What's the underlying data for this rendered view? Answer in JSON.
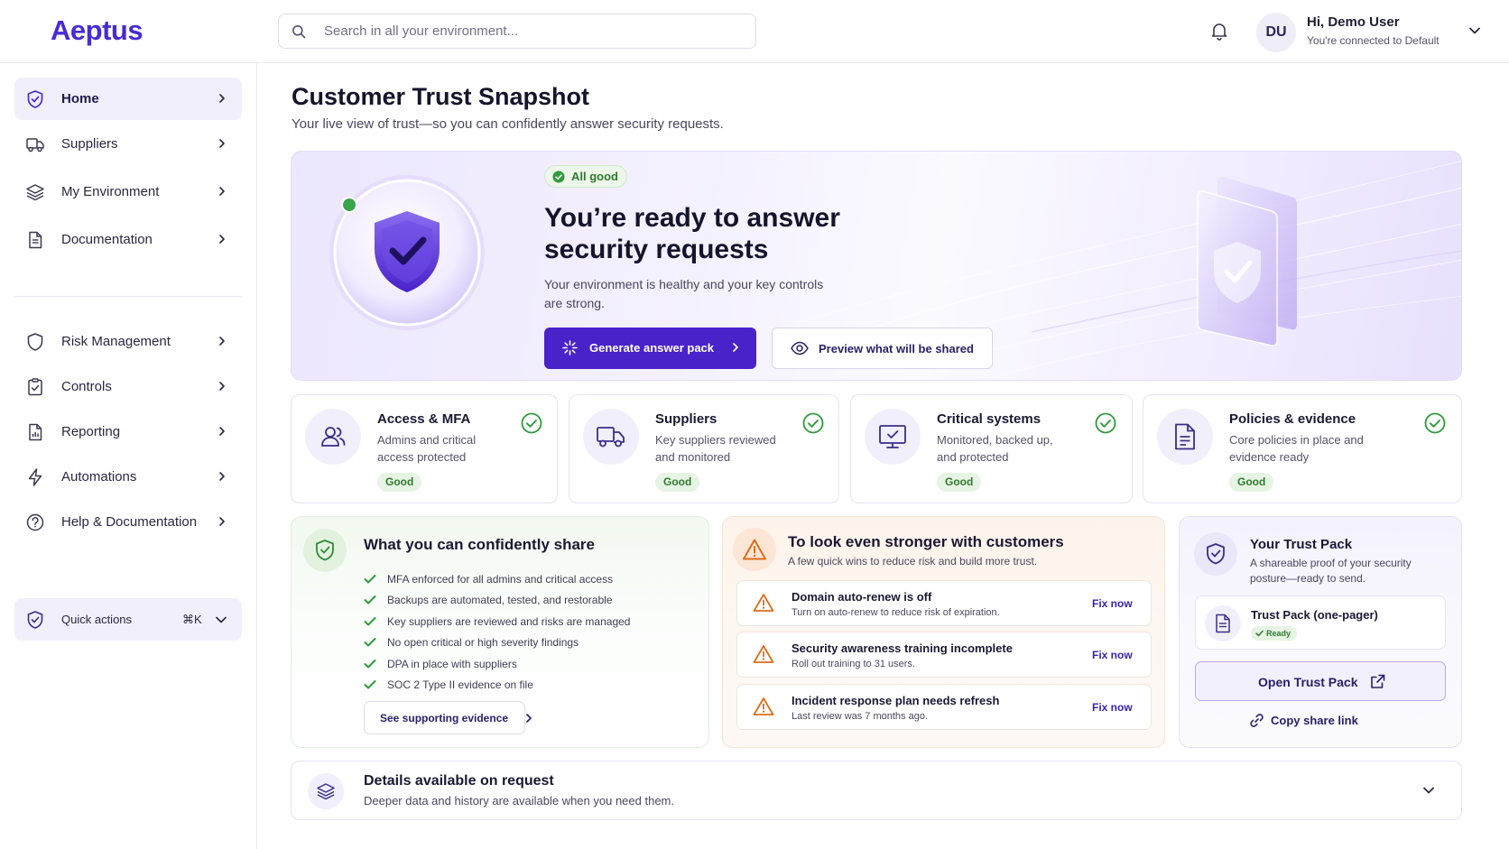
{
  "app": {
    "logo": "Aeptus"
  },
  "header": {
    "search_placeholder": "Search in all your environment...",
    "user_initials": "DU",
    "user_greeting": "Hi, Demo User",
    "user_connection": "You're connected to Default"
  },
  "sidebar": {
    "items": [
      {
        "label": "Home",
        "icon": "shield-check-icon",
        "active": true
      },
      {
        "label": "Suppliers",
        "icon": "truck-icon"
      },
      {
        "label": "My Environment",
        "icon": "layers-icon"
      },
      {
        "label": "Documentation",
        "icon": "document-icon"
      },
      {
        "label": "Risk Management",
        "icon": "shield-icon"
      },
      {
        "label": "Controls",
        "icon": "clipboard-check-icon"
      },
      {
        "label": "Reporting",
        "icon": "report-icon"
      },
      {
        "label": "Automations",
        "icon": "bolt-icon"
      },
      {
        "label": "Help & Documentation",
        "icon": "help-icon"
      }
    ],
    "quick_actions": {
      "label": "Quick actions",
      "shortcut": "⌘K"
    }
  },
  "page": {
    "title": "Customer Trust Snapshot",
    "subtitle": "Your live view of trust—so you can confidently answer security requests."
  },
  "hero": {
    "badge": "All good",
    "title": "You’re ready to answer security requests",
    "description": "Your environment is healthy and your key controls are strong.",
    "primary_button": "Generate answer pack",
    "secondary_button": "Preview what will be shared"
  },
  "status_cards": [
    {
      "title": "Access & MFA",
      "description": "Admins and critical access protected",
      "status": "Good",
      "icon": "users-icon"
    },
    {
      "title": "Suppliers",
      "description": "Key suppliers reviewed and monitored",
      "status": "Good",
      "icon": "truck-icon"
    },
    {
      "title": "Critical systems",
      "description": "Monitored, backed up, and protected",
      "status": "Good",
      "icon": "monitor-check-icon"
    },
    {
      "title": "Policies & evidence",
      "description": "Core policies in place and evidence ready",
      "status": "Good",
      "icon": "document-icon"
    }
  ],
  "share": {
    "title": "What you can confidently share",
    "items": [
      "MFA enforced for all admins and critical access",
      "Backups are automated, tested, and restorable",
      "Key suppliers are reviewed and risks are managed",
      "No open critical or high severity findings",
      "DPA in place with suppliers",
      "SOC 2 Type II evidence on file"
    ],
    "button": "See supporting evidence"
  },
  "stronger": {
    "title": "To look even stronger with customers",
    "subtitle": "A few quick wins to reduce risk and build more trust.",
    "issues": [
      {
        "title": "Domain auto-renew is off",
        "description": "Turn on auto-renew to reduce risk of expiration.",
        "action": "Fix now"
      },
      {
        "title": "Security awareness training incomplete",
        "description": "Roll out training to 31 users.",
        "action": "Fix now"
      },
      {
        "title": "Incident response plan needs refresh",
        "description": "Last review was 7 months ago.",
        "action": "Fix now"
      }
    ]
  },
  "trust_pack": {
    "title": "Your Trust Pack",
    "description": "A shareable proof of your security posture—ready to send.",
    "file_title": "Trust Pack (one-pager)",
    "file_status": "Ready",
    "open_button": "Open Trust Pack",
    "copy_link": "Copy share link"
  },
  "details": {
    "title": "Details available on request",
    "description": "Deeper data and history are available when you need them."
  },
  "colors": {
    "brand": "#4a22c9",
    "good": "#2f9a3c",
    "warning": "#e06b1a"
  }
}
